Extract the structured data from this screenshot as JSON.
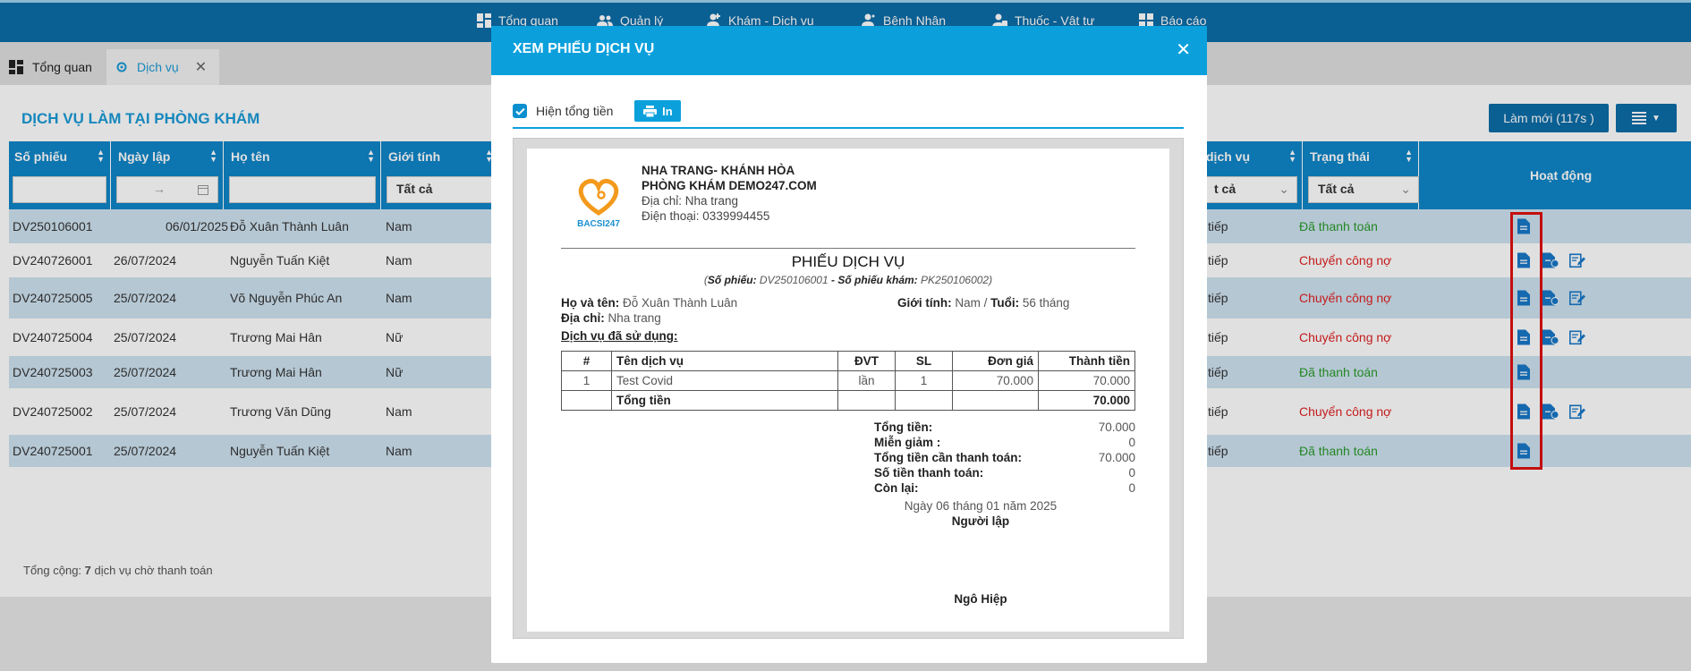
{
  "topnav": {
    "items": [
      {
        "label": "Tổng quan",
        "icon": "dashboard-icon"
      },
      {
        "label": "Quản lý",
        "icon": "users-icon"
      },
      {
        "label": "Khám - Dịch vụ",
        "icon": "user-medical-icon"
      },
      {
        "label": "Bệnh Nhân",
        "icon": "patient-icon"
      },
      {
        "label": "Thuốc - Vật tư",
        "icon": "medicine-icon"
      },
      {
        "label": "Báo cáo",
        "icon": "report-icon"
      }
    ]
  },
  "tabs": [
    {
      "label": "Tổng quan",
      "icon": "dashboard-icon"
    },
    {
      "label": "Dịch vụ",
      "icon": "gear-icon",
      "active": true
    }
  ],
  "page": {
    "title": "DỊCH VỤ LÀM TẠI PHÒNG KHÁM",
    "refresh_label": "Làm mới (117s )"
  },
  "grid": {
    "columns": {
      "so_phieu": "Số phiếu",
      "ngay_lap": "Ngày lập",
      "ho_ten": "Họ tên",
      "gioi_tinh": "Giới tính",
      "dich_vu": "dịch vụ",
      "trang_thai": "Trạng thái",
      "hoat_dong": "Hoạt động"
    },
    "filters": {
      "gioi_tinh": "Tất cả",
      "dich_vu": "t cả",
      "trang_thai": "Tất cả",
      "date_arrow": "→"
    },
    "rows": [
      {
        "so_phieu": "DV250106001",
        "ngay_lap": "06/01/2025",
        "ho_ten": "Đỗ Xuân Thành Luân",
        "gioi_tinh": "Nam",
        "dich_vu": "tiếp",
        "trang_thai": "Đã thanh toán"
      },
      {
        "so_phieu": "DV240726001",
        "ngay_lap": "26/07/2024",
        "ho_ten": "Nguyễn Tuấn Kiệt",
        "gioi_tinh": "Nam",
        "dich_vu": "tiếp",
        "trang_thai": "Chuyển công nợ"
      },
      {
        "so_phieu": "DV240725005",
        "ngay_lap": "25/07/2024",
        "ho_ten": "Võ Nguyễn Phúc An",
        "gioi_tinh": "Nam",
        "dich_vu": "tiếp",
        "trang_thai": "Chuyển công nợ"
      },
      {
        "so_phieu": "DV240725004",
        "ngay_lap": "25/07/2024",
        "ho_ten": "Trương Mai Hân",
        "gioi_tinh": "Nữ",
        "dich_vu": "tiếp",
        "trang_thai": "Chuyển công nợ"
      },
      {
        "so_phieu": "DV240725003",
        "ngay_lap": "25/07/2024",
        "ho_ten": "Trương Mai Hân",
        "gioi_tinh": "Nữ",
        "dich_vu": "tiếp",
        "trang_thai": "Đã thanh toán"
      },
      {
        "so_phieu": "DV240725002",
        "ngay_lap": "25/07/2024",
        "ho_ten": "Trương Văn Dũng",
        "gioi_tinh": "Nam",
        "dich_vu": "tiếp",
        "trang_thai": "Chuyển công nợ"
      },
      {
        "so_phieu": "DV240725001",
        "ngay_lap": "25/07/2024",
        "ho_ten": "Nguyễn Tuấn Kiệt",
        "gioi_tinh": "Nam",
        "dich_vu": "tiếp",
        "trang_thai": "Đã thanh toán"
      }
    ],
    "footer_prefix": "Tổng cộng: ",
    "footer_count": "7",
    "footer_suffix": " dịch vụ chờ thanh toán"
  },
  "colors": {
    "nav_bg": "#0c6da8",
    "header_bg": "#0f86c8",
    "modal_head": "#0ba0dc",
    "paid": "#2a9a2a",
    "debt": "#e02020"
  },
  "modal": {
    "title": "XEM PHIẾU DỊCH VỤ",
    "show_total_label": "Hiện tổng tiền",
    "show_total_checked": true,
    "print_label": "In",
    "doc": {
      "logo_text": "BACSI247",
      "clinic_line1": "NHA TRANG- KHÁNH HÒA",
      "clinic_line2": "PHÒNG KHÁM DEMO247.COM",
      "address_label": "Địa chỉ: ",
      "address_value": "Nha trang",
      "phone_label": "Điện thoại: ",
      "phone_value": "0339994455",
      "title": "PHIẾU DỊCH VỤ",
      "sub_so_phieu_label": "Số phiếu:",
      "sub_so_phieu_value": "DV250106001",
      "sub_sep": " - ",
      "sub_kham_label": "Số phiếu khám:",
      "sub_kham_value": "PK250106002",
      "patient_name_label": "Họ và tên:",
      "patient_name": "Đỗ Xuân Thành Luân",
      "gender_label": "Giới tính:",
      "gender_value": "Nam",
      "age_label": "Tuổi:",
      "age_value": "56 tháng",
      "addr_label": "Địa chỉ:",
      "addr_value": "Nha trang",
      "used_label": "Dịch vụ đã sử dụng:",
      "table_headers": [
        "#",
        "Tên dịch vụ",
        "ĐVT",
        "SL",
        "Đơn giá",
        "Thành tiền"
      ],
      "table_rows": [
        {
          "no": "1",
          "name": "Test Covid",
          "unit": "lần",
          "qty": "1",
          "price": "70.000",
          "amount": "70.000"
        }
      ],
      "total_row_label": "Tổng tiền",
      "total_row_value": "70.000",
      "summary": [
        {
          "label": "Tổng tiền:",
          "value": "70.000"
        },
        {
          "label": "Miễn giảm :",
          "value": "0"
        },
        {
          "label": "Tổng tiền cần thanh toán:",
          "value": "70.000"
        },
        {
          "label": "Số tiền thanh toán:",
          "value": "0"
        },
        {
          "label": "Còn lại:",
          "value": "0"
        }
      ],
      "date_text": "Ngày 06 tháng 01 năm 2025",
      "creator_label": "Người lập",
      "creator_name": "Ngô Hiệp"
    }
  }
}
